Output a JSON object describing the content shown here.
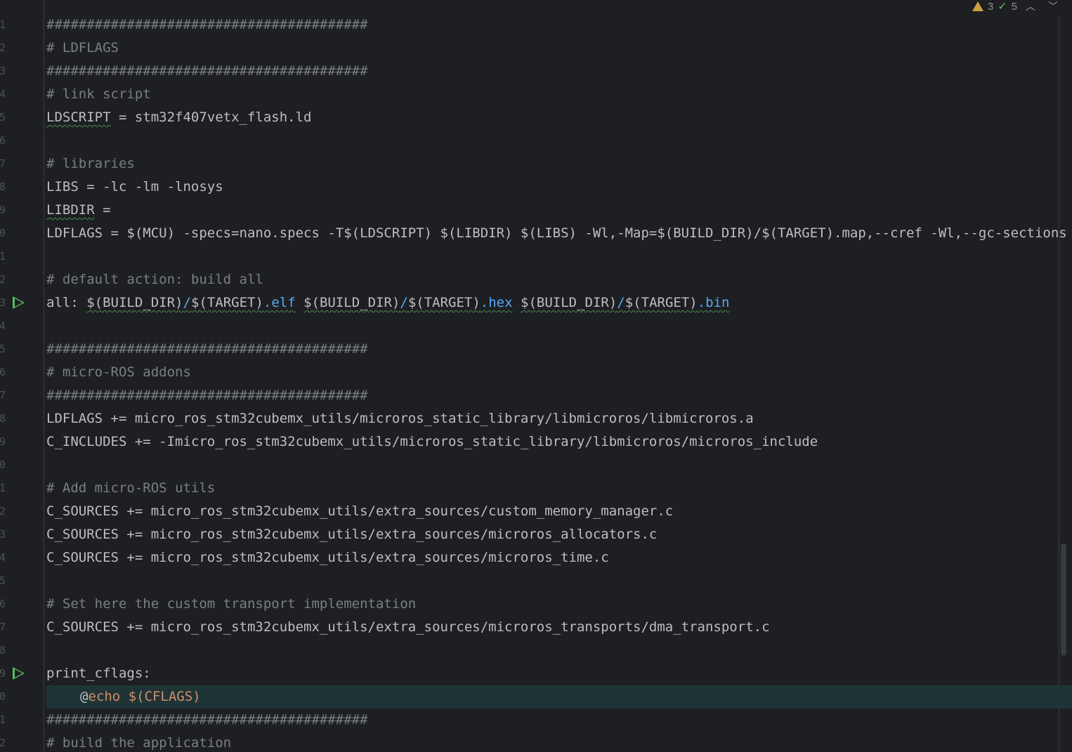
{
  "status": {
    "warnings": "3",
    "checks": "5",
    "warning_icon": "warning-icon",
    "check_icon": "check-icon",
    "prev_icon": "chevron-up-icon",
    "next_icon": "chevron-down-icon"
  },
  "gutter": {
    "numbers": [
      "1",
      "2",
      "3",
      "4",
      "5",
      "6",
      "7",
      "8",
      "9",
      "0",
      "1",
      "2",
      "3",
      "4",
      "5",
      "6",
      "7",
      "8",
      "9",
      "0",
      "1",
      "2",
      "3",
      "4",
      "5",
      "6",
      "7",
      "8",
      "9",
      "0",
      "1",
      "2"
    ]
  },
  "code": {
    "l1": "########################################",
    "l2": "# LDFLAGS",
    "l3": "########################################",
    "l4": "# link script",
    "l5a": "LDSCRIPT",
    "l5b": " = stm32f407vetx_flash.ld",
    "l7": "# libraries",
    "l8": "LIBS = -lc -lm -lnosys",
    "l9a": "LIBDIR",
    "l9b": " =",
    "l10": "LDFLAGS = $(MCU) -specs=nano.specs -T$(LDSCRIPT) $(LIBDIR) $(LIBS) -Wl,-Map=$(BUILD_DIR)/$(TARGET).map,--cref -Wl,--gc-sections",
    "l12": "# default action: build all",
    "l13a": "all: ",
    "l13b": "$(BUILD_DIR)",
    "l13c": "/",
    "l13d": "$(TARGET)",
    "l13e": ".elf",
    "l13f": "$(BUILD_DIR)",
    "l13g": "/",
    "l13h": "$(TARGET)",
    "l13i": ".hex",
    "l13j": "$(BUILD_DIR)",
    "l13k": "/",
    "l13l": "$(TARGET)",
    "l13m": ".bin",
    "l15": "########################################",
    "l16": "# micro-ROS addons",
    "l17": "########################################",
    "l18": "LDFLAGS += micro_ros_stm32cubemx_utils/microros_static_library/libmicroros/libmicroros.a",
    "l19": "C_INCLUDES += -Imicro_ros_stm32cubemx_utils/microros_static_library/libmicroros/microros_include",
    "l21": "# Add micro-ROS utils",
    "l22": "C_SOURCES += micro_ros_stm32cubemx_utils/extra_sources/custom_memory_manager.c",
    "l23": "C_SOURCES += micro_ros_stm32cubemx_utils/extra_sources/microros_allocators.c",
    "l24": "C_SOURCES += micro_ros_stm32cubemx_utils/extra_sources/microros_time.c",
    "l26": "# Set here the custom transport implementation",
    "l27": "C_SOURCES += micro_ros_stm32cubemx_utils/extra_sources/microros_transports/dma_transport.c",
    "l29": "print_cflags:",
    "l30a": "@",
    "l30b": "echo",
    "l30c": " $(CFLAGS)",
    "l31": "########################################",
    "l32": "# build the application"
  },
  "colors": {
    "background": "#1e1f22",
    "comment": "#7a7e85",
    "text": "#bcbec4",
    "extension": "#56a8f5",
    "keyword": "#cf8e6d",
    "run_icon": "#5fb865"
  }
}
